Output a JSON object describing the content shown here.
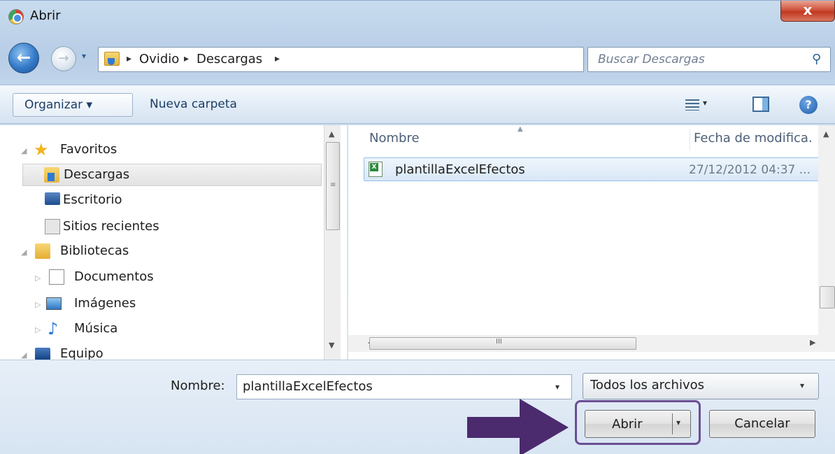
{
  "window": {
    "title": "Abrir",
    "close_glyph": "x",
    "icon": "chrome-icon"
  },
  "navigation": {
    "back_glyph": "←",
    "forward_glyph": "→",
    "recent_glyph": "▾",
    "breadcrumb": [
      {
        "label": "Ovidio"
      },
      {
        "label": "Descargas"
      }
    ],
    "separator_glyph": "▸",
    "dropdown_glyph": "▾",
    "refresh_glyph": "⇆",
    "search_placeholder": "Buscar Descargas",
    "search_icon_glyph": "⚲"
  },
  "commandbar": {
    "organizar_label": "Organizar ▾",
    "nueva_carpeta_label": "Nueva carpeta",
    "view_dropdown_glyph": "▾",
    "help_glyph": "?"
  },
  "navpane": {
    "expander_open": "◢",
    "expander_closed": "▷",
    "items": [
      {
        "label": "Favoritos",
        "icon": "star-icon"
      },
      {
        "label": "Descargas",
        "icon": "downloads-folder-icon",
        "selected": true
      },
      {
        "label": "Escritorio",
        "icon": "desktop-icon"
      },
      {
        "label": "Sitios recientes",
        "icon": "recent-places-icon"
      },
      {
        "label": "Bibliotecas",
        "icon": "libraries-icon"
      },
      {
        "label": "Documentos",
        "icon": "documents-icon"
      },
      {
        "label": "Imágenes",
        "icon": "pictures-icon"
      },
      {
        "label": "Música",
        "icon": "music-icon"
      },
      {
        "label": "Equipo",
        "icon": "computer-icon"
      }
    ],
    "scroll_up_glyph": "▲",
    "scroll_down_glyph": "▼",
    "grip_glyph": "≡"
  },
  "filelist": {
    "columns": [
      {
        "label": "Nombre"
      },
      {
        "label": "Fecha de modifica."
      }
    ],
    "sort_glyph": "▲",
    "rows": [
      {
        "name": "plantillaExcelEfectos",
        "date": "27/12/2012 04:37 ...",
        "icon": "excel-file-icon"
      }
    ],
    "scroll_left_glyph": "◀",
    "scroll_right_glyph": "▶",
    "scroll_up_glyph": "▲",
    "hgrip_glyph": "III"
  },
  "footer": {
    "name_label": "Nombre:",
    "name_value": "plantillaExcelEfectos",
    "name_dropdown_glyph": "▾",
    "filetype_value": "Todos los archivos",
    "filetype_dropdown_glyph": "▾",
    "open_label": "Abrir",
    "open_dropdown_glyph": "▾",
    "cancel_label": "Cancelar"
  },
  "annotation": {
    "arrow_color": "#4b2a6e",
    "highlight_color": "#6a4f93"
  }
}
